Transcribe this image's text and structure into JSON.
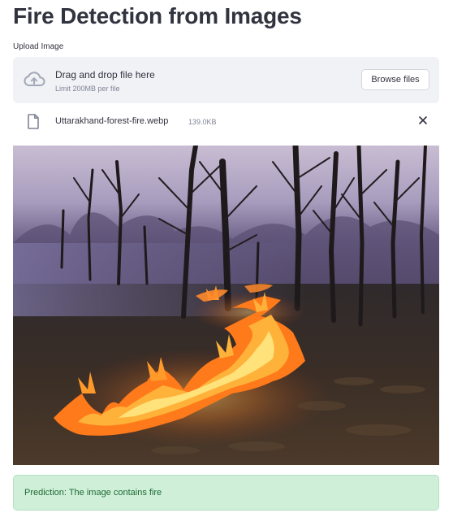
{
  "page": {
    "title": "Fire Detection from Images"
  },
  "uploader": {
    "label": "Upload Image",
    "dropzone_title": "Drag and drop file here",
    "dropzone_limit": "Limit 200MB per file",
    "browse_label": "Browse files",
    "cloud_icon": "cloud-upload-icon"
  },
  "file": {
    "name": "Uttarakhand-forest-fire.webp",
    "size": "139.0KB",
    "icon": "file-icon",
    "remove_icon": "close-icon"
  },
  "image": {
    "subject": "forest-fire-photo"
  },
  "result": {
    "text": "Prediction: The image contains fire",
    "colors": {
      "background": "#D0EFD9",
      "text": "#1C6A33"
    }
  }
}
